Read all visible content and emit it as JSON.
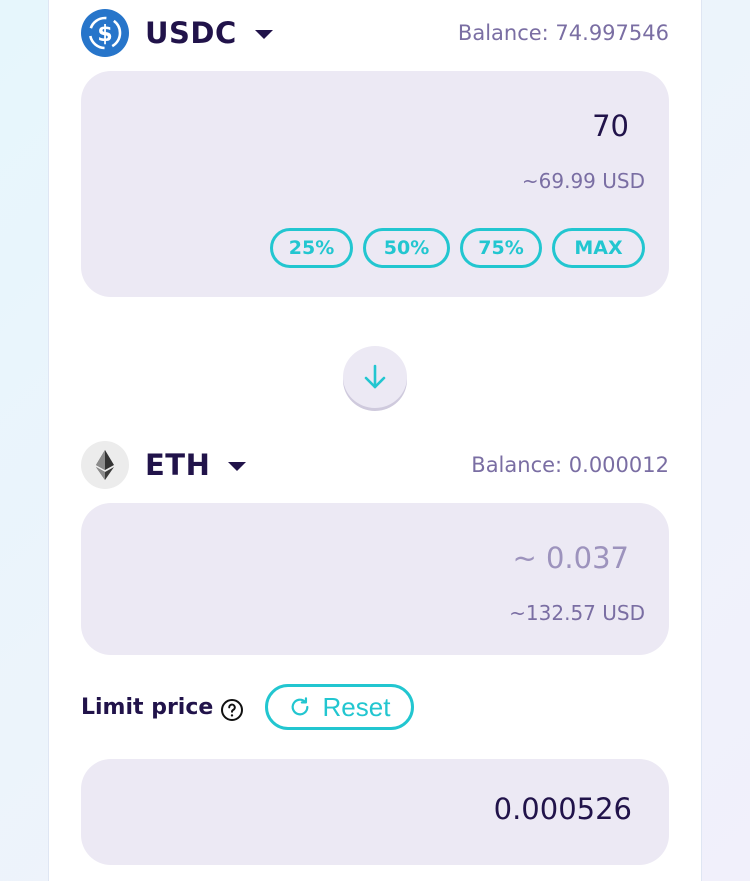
{
  "colors": {
    "accent": "#22c6d0",
    "text_dark": "#21134a",
    "text_muted": "#7a6ea3",
    "panel_bg": "#ece9f4",
    "usdc_blue": "#2775ca"
  },
  "from_token": {
    "symbol": "USDC",
    "icon": "usdc-icon",
    "balance_label": "Balance: 74.997546",
    "amount": "70",
    "usd_value": "~69.99 USD",
    "percent_buttons": [
      "25%",
      "50%",
      "75%",
      "MAX"
    ]
  },
  "swap_direction_icon": "arrow-down-icon",
  "to_token": {
    "symbol": "ETH",
    "icon": "eth-icon",
    "balance_label": "Balance: 0.000012",
    "amount": "~ 0.037",
    "usd_value": "~132.57 USD"
  },
  "limit": {
    "label": "Limit price",
    "help_icon": "question-circle-icon",
    "reset_label": "Reset",
    "reset_icon": "refresh-icon",
    "value": "0.000526"
  }
}
